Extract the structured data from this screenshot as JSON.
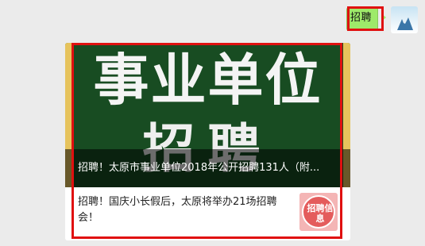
{
  "message": {
    "text": "招聘"
  },
  "article": {
    "cover_line1": "事业单位",
    "cover_line2": "招聘",
    "cover_caption": "招聘！太原市事业单位2018年公开招聘131人（附...",
    "second_title": "招聘！国庆小长假后，太原将举办21场招聘会！",
    "thumb_text": "招聘信息"
  },
  "colors": {
    "bubble": "#9eea6a",
    "highlight": "#e01010",
    "cover_bg": "#184c22"
  }
}
